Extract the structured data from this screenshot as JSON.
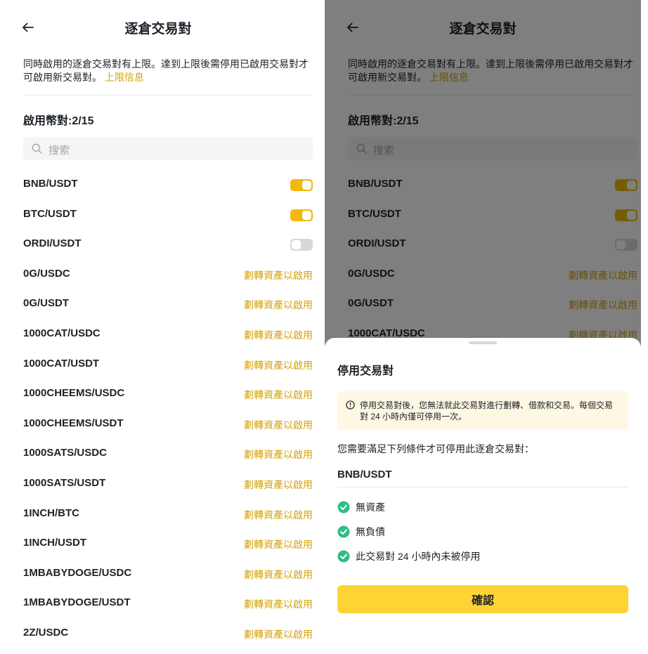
{
  "colors": {
    "accent": "#f0b90b",
    "link": "#d4a20c",
    "confirm_bg": "#fcd535",
    "toggle_off": "#d6d9dc",
    "check_green": "#2ebd85",
    "notice_bg": "#fdf7e4"
  },
  "header": {
    "back_icon": "arrow-left-icon",
    "title": "逐倉交易對"
  },
  "notice": {
    "text": "同時啟用的逐倉交易對有上限。達到上限後需停用已啟用交易對才可啟用新交易對。",
    "link": "上限信息"
  },
  "enabled_count": "啟用幣對:2/15",
  "search": {
    "icon": "search-icon",
    "placeholder": "搜索"
  },
  "pairs": [
    {
      "symbol": "BNB/USDT",
      "type": "toggle",
      "enabled": true
    },
    {
      "symbol": "BTC/USDT",
      "type": "toggle",
      "enabled": true
    },
    {
      "symbol": "ORDI/USDT",
      "type": "toggle",
      "enabled": false
    },
    {
      "symbol": "0G/USDC",
      "type": "action",
      "action": "劃轉資產以啟用"
    },
    {
      "symbol": "0G/USDT",
      "type": "action",
      "action": "劃轉資產以啟用"
    },
    {
      "symbol": "1000CAT/USDC",
      "type": "action",
      "action": "劃轉資產以啟用"
    },
    {
      "symbol": "1000CAT/USDT",
      "type": "action",
      "action": "劃轉資產以啟用"
    },
    {
      "symbol": "1000CHEEMS/USDC",
      "type": "action",
      "action": "劃轉資產以啟用"
    },
    {
      "symbol": "1000CHEEMS/USDT",
      "type": "action",
      "action": "劃轉資產以啟用"
    },
    {
      "symbol": "1000SATS/USDC",
      "type": "action",
      "action": "劃轉資產以啟用"
    },
    {
      "symbol": "1000SATS/USDT",
      "type": "action",
      "action": "劃轉資產以啟用"
    },
    {
      "symbol": "1INCH/BTC",
      "type": "action",
      "action": "劃轉資產以啟用"
    },
    {
      "symbol": "1INCH/USDT",
      "type": "action",
      "action": "劃轉資產以啟用"
    },
    {
      "symbol": "1MBABYDOGE/USDC",
      "type": "action",
      "action": "劃轉資產以啟用"
    },
    {
      "symbol": "1MBABYDOGE/USDT",
      "type": "action",
      "action": "劃轉資產以啟用"
    },
    {
      "symbol": "2Z/USDC",
      "type": "action",
      "action": "劃轉資產以啟用"
    }
  ],
  "sheet": {
    "title": "停用交易對",
    "warning_icon": "info-circle-icon",
    "warning": "停用交易對後，您無法就此交易對進行劃轉、借款和交易。每個交易對 24 小時內僅可停用一次。",
    "requirement": "您需要滿足下列條件才可停用此逐倉交易對：",
    "pair": "BNB/USDT",
    "conditions": [
      {
        "icon": "check-circle-icon",
        "text": "無資產"
      },
      {
        "icon": "check-circle-icon",
        "text": "無負債"
      },
      {
        "icon": "check-circle-icon",
        "text": "此交易對 24 小時內未被停用"
      }
    ],
    "confirm": "確認"
  }
}
